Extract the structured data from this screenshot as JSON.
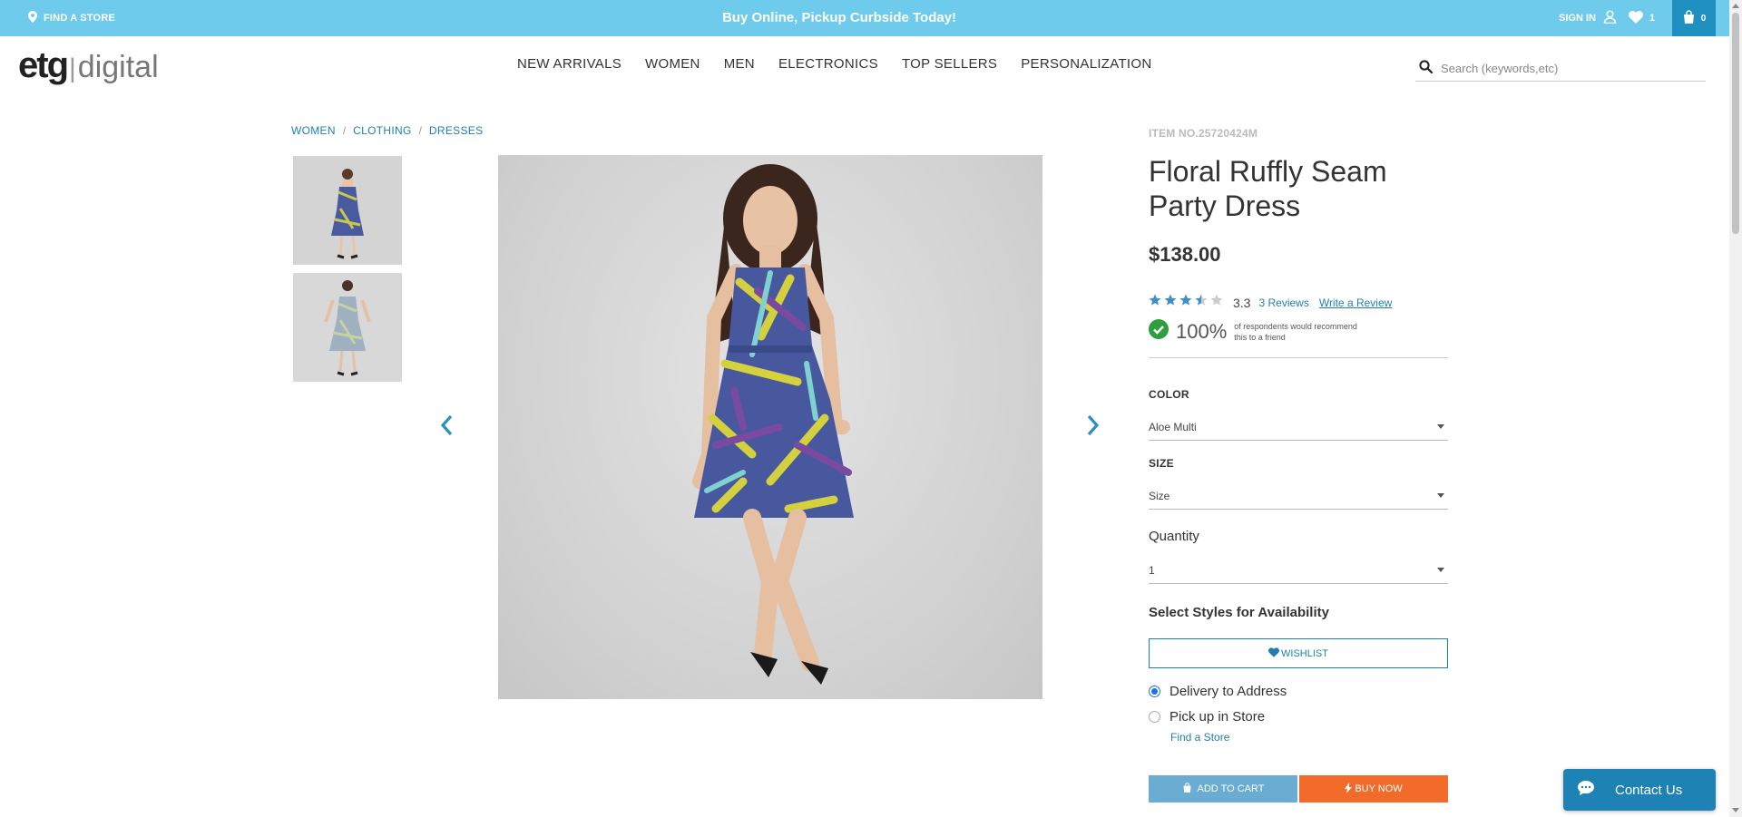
{
  "topbar": {
    "find_store": "FIND A STORE",
    "promo": "Buy Online, Pickup Curbside Today!",
    "signin": "SIGN IN",
    "wishlist_count": "1",
    "cart_count": "0"
  },
  "logo": {
    "brand": "etg",
    "sub": "digital"
  },
  "nav": {
    "items": [
      "NEW ARRIVALS",
      "WOMEN",
      "MEN",
      "ELECTRONICS",
      "TOP SELLERS",
      "PERSONALIZATION"
    ]
  },
  "search": {
    "placeholder": "Search (keywords,etc)"
  },
  "breadcrumb": {
    "items": [
      "WOMEN",
      "CLOTHING",
      "DRESSES"
    ],
    "separator": "/"
  },
  "product": {
    "item_no": "ITEM NO.25720424M",
    "title": "Floral Ruffly Seam Party Dress",
    "price": "$138.00",
    "rating": 3.3,
    "rating_text": "3.3",
    "reviews": "3 Reviews",
    "write_review": "Write a Review",
    "recommend_pct": "100%",
    "recommend_text": "of respondents would recommend this to a friend"
  },
  "options": {
    "color_label": "COLOR",
    "color_value": "Aloe Multi",
    "size_label": "SIZE",
    "size_value": "Size",
    "quantity_label": "Quantity",
    "quantity_value": "1"
  },
  "availability": {
    "title": "Select Styles for Availability",
    "wishlist_label": "WISHLIST",
    "delivery": "Delivery to Address",
    "pickup": "Pick up in Store",
    "find_store": "Find a Store",
    "selected": "delivery"
  },
  "actions": {
    "add_to_cart": "ADD TO CART",
    "buy_now": "BUY NOW"
  },
  "chat": {
    "label": "Contact Us"
  },
  "colors": {
    "topbar": "#6ecbec",
    "link": "#1f7fb0",
    "star": "#3f8fc4",
    "buy_now": "#f36b2b",
    "add_to_cart": "#6aacd2",
    "check": "#2e9e3e"
  },
  "icons": [
    "pin-icon",
    "user-icon",
    "heart-icon",
    "bag-icon",
    "search-icon",
    "chevron-left-icon",
    "chevron-right-icon",
    "check-icon",
    "chat-icon",
    "bolt-icon"
  ]
}
